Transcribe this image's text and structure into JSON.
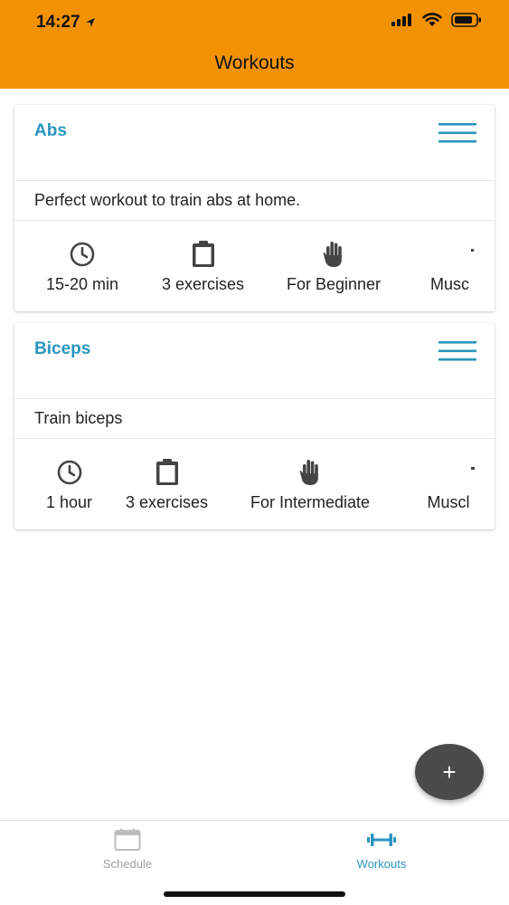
{
  "status_bar": {
    "time": "14:27"
  },
  "header": {
    "title": "Workouts"
  },
  "workouts": [
    {
      "title": "Abs",
      "description": "Perfect workout to train abs at home.",
      "duration": "15-20 min",
      "exercises": "3 exercises",
      "level": "For Beginner",
      "muscle": "Musc"
    },
    {
      "title": "Biceps",
      "description": "Train biceps",
      "duration": "1 hour",
      "exercises": "3 exercises",
      "level": "For Intermediate",
      "muscle": "Muscl"
    }
  ],
  "fab": {
    "label": "+"
  },
  "tabbar": {
    "schedule": "Schedule",
    "workouts": "Workouts"
  },
  "colors": {
    "header_bg": "#F39200",
    "accent": "#2A95BF",
    "fab_bg": "#4A4A4A",
    "inactive_tab": "#9E9E9E"
  },
  "icons": [
    "clock-icon",
    "clipboard-icon",
    "hand-icon",
    "menu-icon",
    "calendar-icon",
    "dumbbell-icon",
    "plus-icon"
  ]
}
